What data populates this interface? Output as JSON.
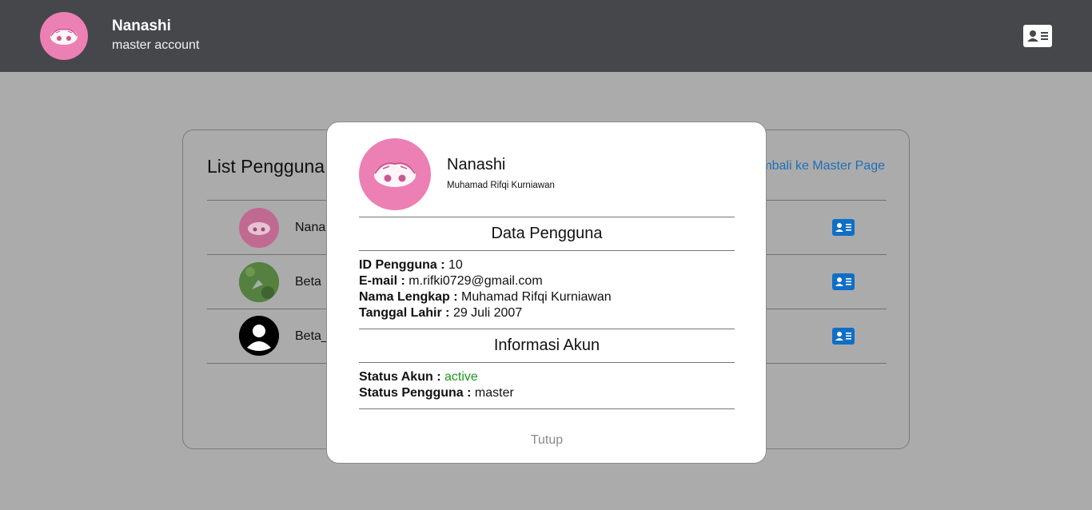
{
  "header": {
    "account_name": "Nanashi",
    "account_role": "master account",
    "avatar_icon": "anime-avatar-icon",
    "card_button_icon": "id-card-icon"
  },
  "panel": {
    "title": "List Pengguna",
    "back_link": "mbali ke Master Page",
    "users": [
      {
        "name": "Nana",
        "avatar": "anime-avatar-icon"
      },
      {
        "name": "Beta",
        "avatar": "photo-avatar"
      },
      {
        "name": "Beta_",
        "avatar": "default-user-icon"
      }
    ]
  },
  "modal": {
    "name": "Nanashi",
    "full_name_subtitle": "Muhamad Rifqi Kurniawan",
    "section_user": "Data Pengguna",
    "fields": {
      "id_label": "ID Pengguna :",
      "id_value": "10",
      "email_label": "E-mail :",
      "email_value": "m.rifki0729@gmail.com",
      "name_label": "Nama Lengkap :",
      "name_value": "Muhamad Rifqi Kurniawan",
      "dob_label": "Tanggal Lahir :",
      "dob_value": "29 Juli 2007"
    },
    "section_account": "Informasi Akun",
    "account": {
      "status_label": "Status Akun :",
      "status_value": "active",
      "role_label": "Status Pengguna :",
      "role_value": "master"
    },
    "close_label": "Tutup"
  },
  "colors": {
    "header_bg": "#46474b",
    "overlay_bg": "#ababab",
    "avatar_pink": "#ec7fb3",
    "accent_blue": "#0f6fc6",
    "active_green": "#1a9a1a"
  }
}
